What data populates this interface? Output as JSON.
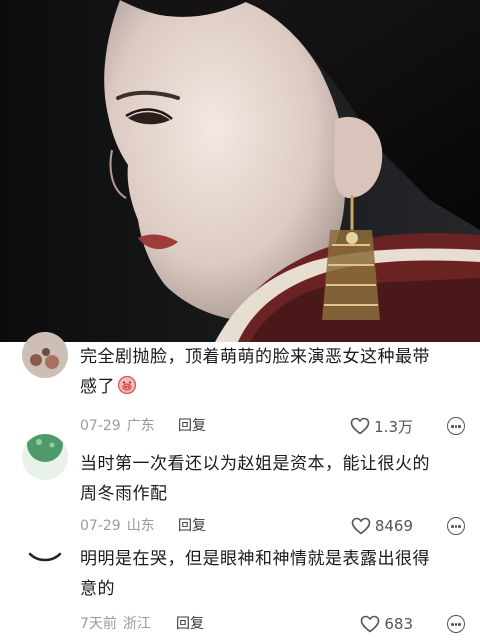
{
  "comments": [
    {
      "line1": "完全剧抛脸，顶着萌萌的脸来演恶女这种最带",
      "line2": "感了",
      "emoji": "pig-face-emoji",
      "date": "07-29",
      "location": "广东",
      "reply_label": "回复",
      "likes": "1.3万"
    },
    {
      "line1": "当时第一次看还以为赵姐是资本，能让很火的",
      "line2": "周冬雨作配",
      "date": "07-29",
      "location": "山东",
      "reply_label": "回复",
      "likes": "8469"
    },
    {
      "line1": "明明是在哭，但是眼神和神情就是表露出很得",
      "line2": "意的",
      "date": "7天前",
      "location": "浙江",
      "reply_label": "回复",
      "likes": "683"
    }
  ],
  "icons": {
    "like": "heart-outline-icon",
    "more": "more-options-icon"
  },
  "colors": {
    "text": "#1a1a1a",
    "meta": "#9a9a9a",
    "reply": "#3a3a3a"
  }
}
